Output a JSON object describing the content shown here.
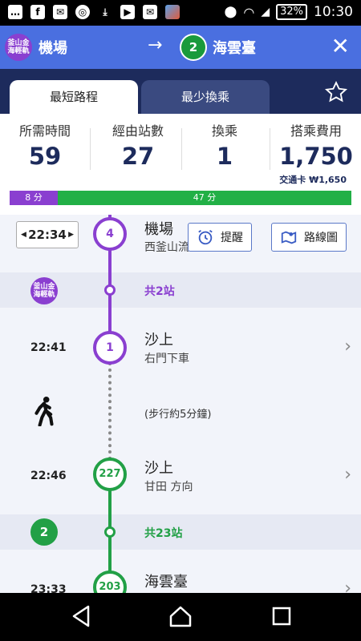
{
  "status_bar": {
    "icons": [
      "chat-icon",
      "facebook-icon",
      "mail-icon",
      "chrome-icon",
      "download-icon",
      "youtube-icon",
      "mail-icon",
      "photo-icon"
    ],
    "battery": "32%",
    "time": "10:30"
  },
  "header": {
    "from_badge": "釜山金海輕軌",
    "from_name": "機場",
    "arrow": "→",
    "to_badge": "2",
    "to_name": "海雲臺",
    "close": "✕"
  },
  "tabs": [
    {
      "label": "最短路程",
      "active": true
    },
    {
      "label": "最少換乘",
      "active": false
    }
  ],
  "stats": {
    "time_label": "所需時間",
    "time_value": "59",
    "stations_label": "經由站數",
    "stations_value": "27",
    "transfers_label": "換乘",
    "transfers_value": "1",
    "fare_label": "搭乘費用",
    "fare_value": "1,750",
    "fare_card": "交通卡 ₩1,650"
  },
  "progress": {
    "segments": [
      {
        "label": "8 分",
        "minutes": 8,
        "color": "#8a3fd0"
      },
      {
        "label": "47 分",
        "minutes": 47,
        "color": "#22b046"
      }
    ]
  },
  "timeline": {
    "departure_time": "22:34",
    "start_station_number": "4",
    "start_station_name": "機場",
    "start_station_sub": "西釜山流",
    "reminder_label": "提醒",
    "map_label": "路線圖",
    "line1_badge": "釜山金海輕軌",
    "line1_count": "共2站",
    "stop1_time": "22:41",
    "stop1_number": "1",
    "stop1_name": "沙上",
    "stop1_sub": "右門下車",
    "walk_label": "(步行約5分鐘)",
    "stop2_time": "22:46",
    "stop2_number": "227",
    "stop2_name": "沙上",
    "stop2_sub": "甘田 方向",
    "line2_badge": "2",
    "line2_count": "共23站",
    "stop3_time": "23:33",
    "stop3_number": "203",
    "stop3_name": "海雲臺"
  },
  "colors": {
    "header": "#4a6fe0",
    "navy": "#1d2b5c",
    "line1": "#8a3fd0",
    "line2": "#22a046"
  }
}
